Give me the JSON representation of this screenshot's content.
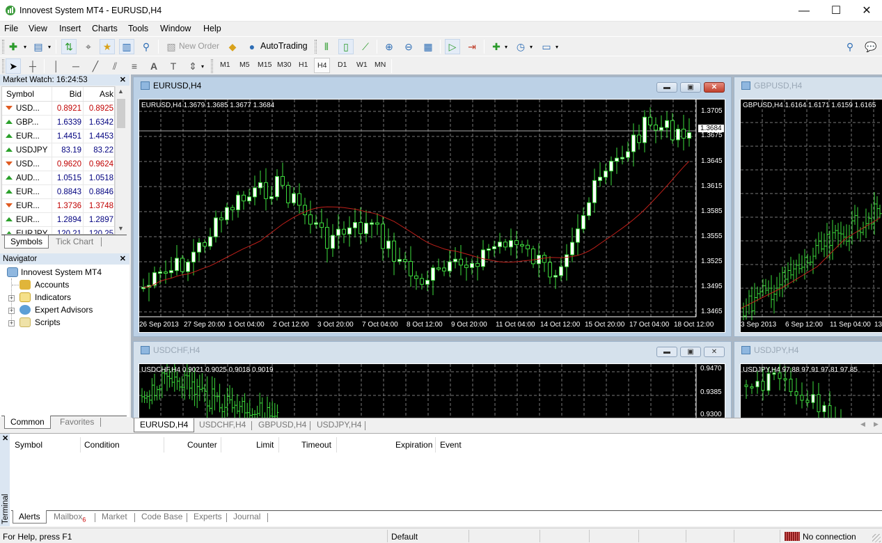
{
  "app": {
    "title": "Innovest System MT4 - EURUSD,H4"
  },
  "window_controls": {
    "minimize": "—",
    "maximize": "☐",
    "close": "✕"
  },
  "menu": [
    "File",
    "View",
    "Insert",
    "Charts",
    "Tools",
    "Window",
    "Help"
  ],
  "toolbar": {
    "new_order": "New Order",
    "auto_trading": "AutoTrading",
    "icons": [
      "new-chart-icon",
      "profiles-icon",
      "market-watch-icon",
      "data-window-icon",
      "navigator-icon",
      "terminal-icon",
      "strategy-tester-icon",
      "new-order-icon",
      "metaeditor-icon",
      "autotrading-icon",
      "bar-chart-icon",
      "candlestick-icon",
      "line-chart-icon",
      "zoom-in-icon",
      "zoom-out-icon",
      "tile-windows-icon",
      "autoscroll-icon",
      "chart-shift-icon",
      "indicators-icon",
      "periods-icon",
      "templates-icon",
      "search-icon",
      "chat-icon"
    ]
  },
  "timeframes": [
    "M1",
    "M5",
    "M15",
    "M30",
    "H1",
    "H4",
    "D1",
    "W1",
    "MN"
  ],
  "active_timeframe": "H4",
  "market_watch": {
    "title": "Market Watch: 16:24:53",
    "columns": [
      "Symbol",
      "Bid",
      "Ask"
    ],
    "rows": [
      {
        "symbol": "USD...",
        "bid": "0.8921",
        "ask": "0.8925",
        "dir": "down"
      },
      {
        "symbol": "GBP...",
        "bid": "1.6339",
        "ask": "1.6342",
        "dir": "up"
      },
      {
        "symbol": "EUR...",
        "bid": "1.4451",
        "ask": "1.4453",
        "dir": "up"
      },
      {
        "symbol": "USDJPY",
        "bid": "83.19",
        "ask": "83.22",
        "dir": "up"
      },
      {
        "symbol": "USD...",
        "bid": "0.9620",
        "ask": "0.9624",
        "dir": "down"
      },
      {
        "symbol": "AUD...",
        "bid": "1.0515",
        "ask": "1.0518",
        "dir": "up"
      },
      {
        "symbol": "EUR...",
        "bid": "0.8843",
        "ask": "0.8846",
        "dir": "up"
      },
      {
        "symbol": "EUR...",
        "bid": "1.3736",
        "ask": "1.3748",
        "dir": "down"
      },
      {
        "symbol": "EUR...",
        "bid": "1.2894",
        "ask": "1.2897",
        "dir": "up"
      },
      {
        "symbol": "EURJPY",
        "bid": "120.21",
        "ask": "120.25",
        "dir": "up"
      }
    ],
    "tabs": [
      "Symbols",
      "Tick Chart"
    ]
  },
  "navigator": {
    "title": "Navigator",
    "root": "Innovest System MT4",
    "items": [
      "Accounts",
      "Indicators",
      "Expert Advisors",
      "Scripts"
    ],
    "tabs": [
      "Common",
      "Favorites"
    ]
  },
  "charts": {
    "eurusd": {
      "title": "EURUSD,H4",
      "info": "EURUSD,H4  1.3679 1.3685 1.3677 1.3684",
      "price_labels": [
        "1.3705",
        "1.3675",
        "1.3645",
        "1.3615",
        "1.3585",
        "1.3555",
        "1.3525",
        "1.3495",
        "1.3465"
      ],
      "current_price": "1.3684",
      "time_labels": [
        "26 Sep 2013",
        "27 Sep 20:00",
        "1 Oct 04:00",
        "2 Oct 12:00",
        "3 Oct 20:00",
        "7 Oct 04:00",
        "8 Oct 12:00",
        "9 Oct 20:00",
        "11 Oct 04:00",
        "14 Oct 12:00",
        "15 Oct 20:00",
        "17 Oct 04:00",
        "18 Oct 12:00"
      ]
    },
    "gbpusd": {
      "title": "GBPUSD,H4",
      "info": "GBPUSD,H4  1.6164 1.6171 1.6159 1.6165",
      "time_labels": [
        "3 Sep 2013",
        "6 Sep 12:00",
        "11 Sep 04:00",
        "13"
      ]
    },
    "usdchf": {
      "title": "USDCHF,H4",
      "info": "USDCHF,H4  0.9021 0.9025 0.9018 0.9019",
      "price_labels": [
        "0.9470",
        "0.9385",
        "0.9300"
      ]
    },
    "usdjpy": {
      "title": "USDJPY,H4",
      "info": "USDJPY,H4  97.88 97.91 97.81 97.85"
    }
  },
  "chart_tabs": [
    "EURUSD,H4",
    "USDCHF,H4",
    "GBPUSD,H4",
    "USDJPY,H4"
  ],
  "terminal": {
    "label": "Terminal",
    "columns": [
      "Symbol",
      "Condition",
      "Counter",
      "Limit",
      "Timeout",
      "Expiration",
      "Event"
    ],
    "tabs": [
      "Alerts",
      "Mailbox",
      "Market",
      "Code Base",
      "Experts",
      "Journal"
    ],
    "mailbox_count": "6"
  },
  "statusbar": {
    "help": "For Help, press F1",
    "profile": "Default",
    "connection": "No connection"
  }
}
